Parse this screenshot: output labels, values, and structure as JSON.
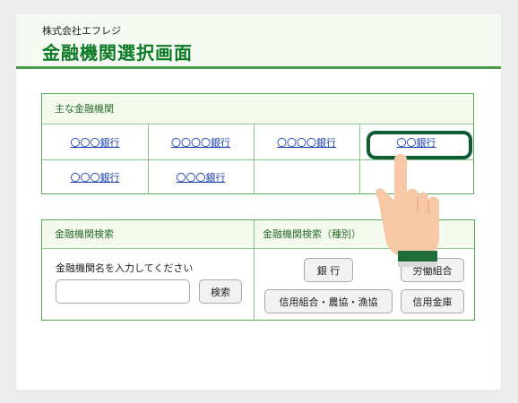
{
  "header": {
    "company": "株式会社エフレジ",
    "title": "金融機関選択画面"
  },
  "major_banks": {
    "heading": "主な金融機関",
    "rows": [
      [
        "〇〇〇銀行",
        "〇〇〇〇銀行",
        "〇〇〇〇銀行",
        "〇〇銀行"
      ],
      [
        "〇〇〇銀行",
        "〇〇〇銀行",
        "",
        ""
      ]
    ]
  },
  "search": {
    "name_heading": "金融機関検索",
    "type_heading": "金融機関検索（種別）",
    "name_label": "金融機関名を入力してください",
    "input_value": "",
    "search_button": "検索",
    "types": [
      "銀 行",
      "労働組合",
      "信用組合・農協・漁協",
      "信用金庫"
    ]
  },
  "colors": {
    "accent": "#0d7a26",
    "border": "#5aa85a",
    "link": "#1b3fb0",
    "highlight": "#0e5c33"
  },
  "icons": {
    "pointer": "pointing-hand-icon"
  }
}
